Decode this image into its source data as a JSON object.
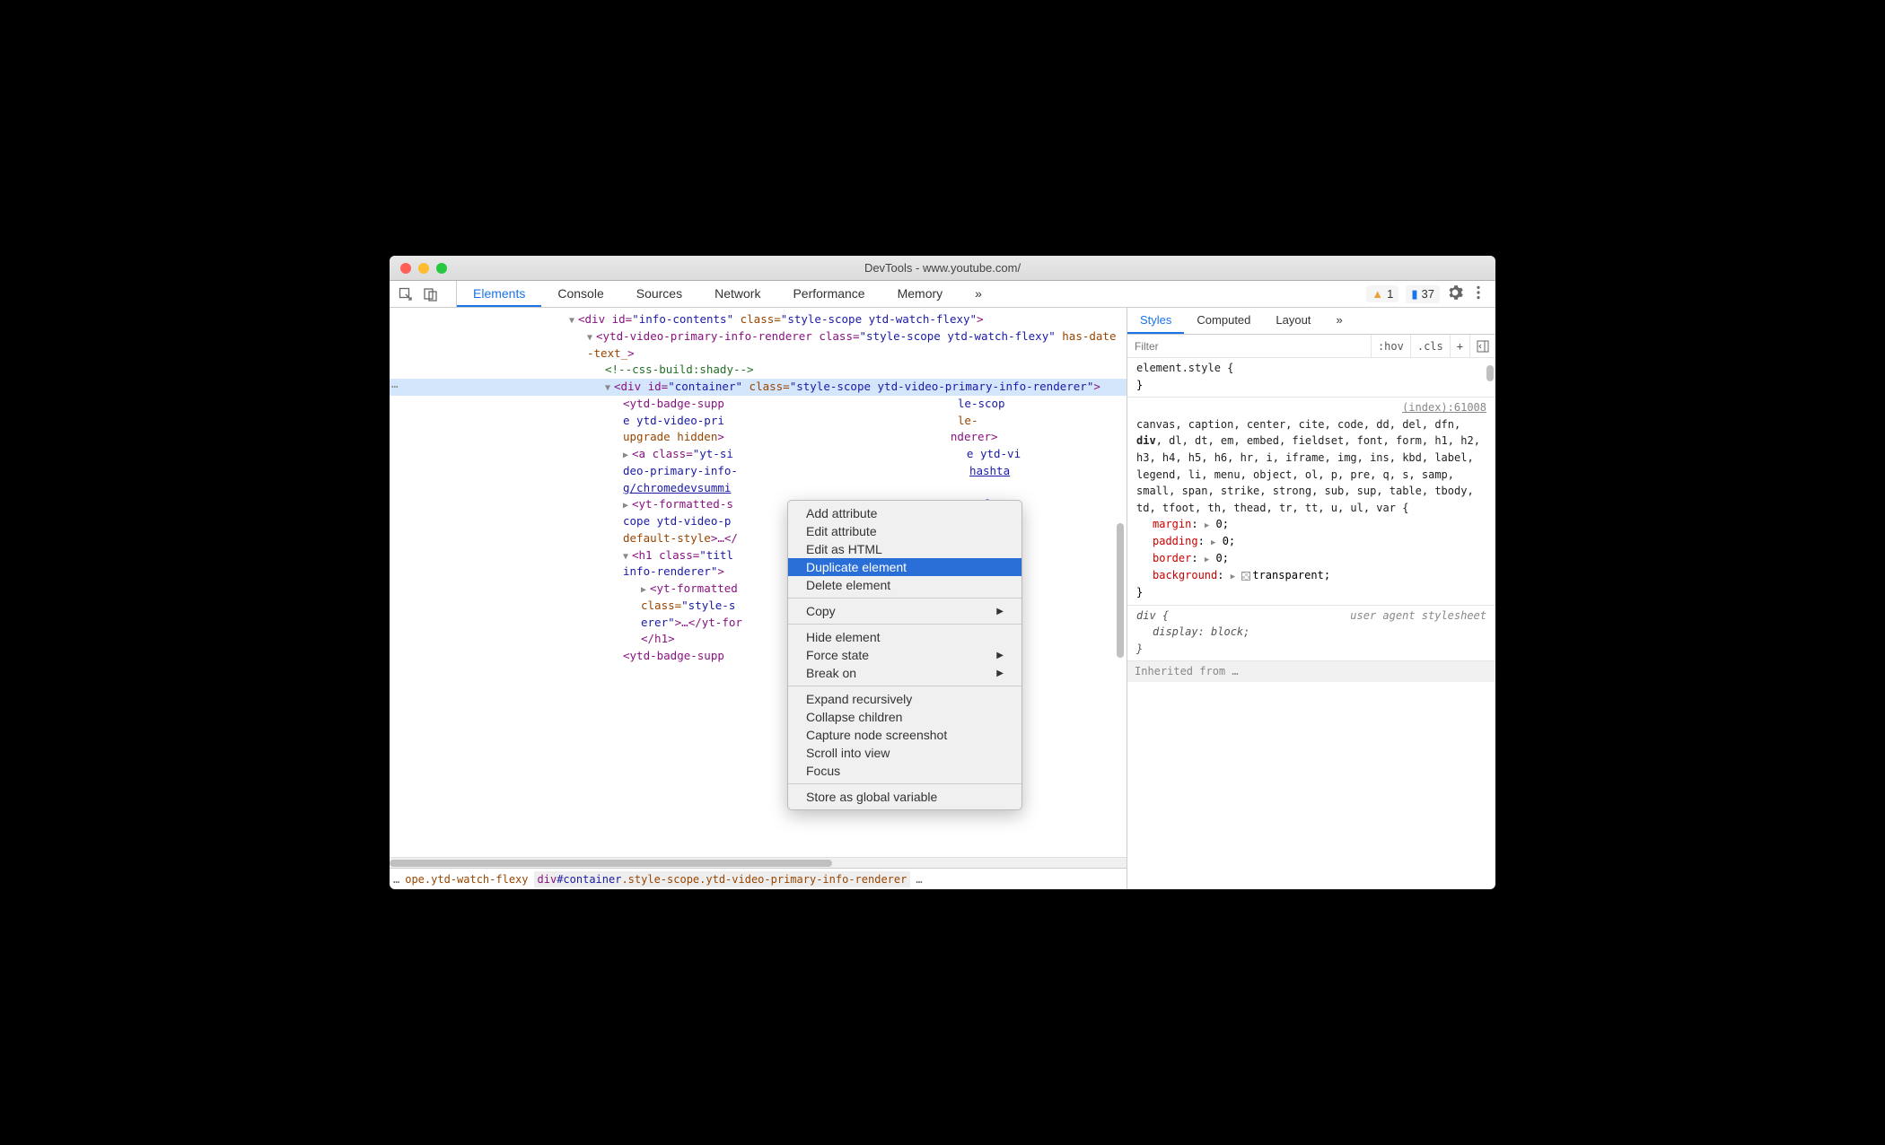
{
  "window_title": "DevTools - www.youtube.com/",
  "toolbar": {
    "tabs": [
      "Elements",
      "Console",
      "Sources",
      "Network",
      "Performance",
      "Memory"
    ],
    "active_tab": "Elements",
    "more": "»",
    "warnings": "1",
    "messages": "37"
  },
  "dom": {
    "line1_pre": "<div id=",
    "line1_id": "\"info-contents\"",
    "line1_class_attr": " class=",
    "line1_class_val": "\"style-scope ytd-watch-flexy\"",
    "line1_close": ">",
    "line2_pre": "<ytd-video-primary-info-renderer class=",
    "line2_class_val": "\"style-scope ytd-watch-flexy\"",
    "line2_hdt": " has-date-text_",
    "line2_close": ">",
    "comment": "<!--css-build:shady-->",
    "sel_pre": "<div id=",
    "sel_id": "\"container\"",
    "sel_class_attr": " class=",
    "sel_class_val": "\"style-scope ytd-video-primary-info-renderer\"",
    "sel_close": ">",
    "badge_pre": "<ytd-badge-supp",
    "badge_mid": " le-scope ytd-video-pri",
    "badge_mid2": " le-upgrade hidden>",
    "badge_end": "nderer>",
    "a_pre": "<a class=",
    "a_class": "\"yt-si",
    "a_mid": " ytd-video-primary-info-",
    "a_url": "hashtag/chromedevsummit",
    "ytf_pre": "<yt-formatted-s",
    "ytf_mid": "style-scope ytd-video-p",
    "ytf_mid2": "ce-default-style>",
    "ytf_close": "…</",
    "h1_pre": "<h1 class=",
    "h1_class": "\"titl",
    "h1_mid": "primary-info-renderer\"",
    "h1_close": ">",
    "h1_inner_pre": "<yt-formatted",
    "h1_inner_class": "class=\"style-s",
    "h1_inner_mid": "fo-renderer\">…</yt-for",
    "h1_end": "</h1>",
    "last_pre": "<ytd-badge-supp",
    "last_end": "le-scop"
  },
  "breadcrumb": {
    "ellipsis_left": "…",
    "item1": "ope.ytd-watch-flexy",
    "item2_tag": "div",
    "item2_id": "#container",
    "item2_cls": ".style-scope.ytd-video-primary-info-renderer",
    "ellipsis_right": "…"
  },
  "styles": {
    "tabs": [
      "Styles",
      "Computed",
      "Layout"
    ],
    "more": "»",
    "filter_placeholder": "Filter",
    "hov": ":hov",
    "cls": ".cls",
    "plus": "+",
    "element_style_sel": "element.style {",
    "rule1_source": "(index):61008",
    "rule1_selector": "canvas, caption, center, cite, code, dd, del, dfn, div, dl, dt, em, embed, fieldset, font, form, h1, h2, h3, h4, h5, h6, hr, i, iframe, img, ins, kbd, label, legend, li, menu, object, ol, p, pre, q, s, samp, small, span, strike, strong, sub, sup, table, tbody, td, tfoot, th, thead, tr, tt, u, ul, var {",
    "margin": "margin",
    "margin_v": "0",
    "padding": "padding",
    "padding_v": "0",
    "border": "border",
    "border_v": "0",
    "background": "background",
    "background_v": "transparent",
    "brace_close": "}",
    "ua_label": "user agent stylesheet",
    "ua_selector": "div {",
    "display": "display",
    "display_v": "block",
    "inherited": "Inherited from …"
  },
  "context_menu": {
    "items": [
      {
        "label": "Add attribute",
        "highlighted": false
      },
      {
        "label": "Edit attribute",
        "highlighted": false
      },
      {
        "label": "Edit as HTML",
        "highlighted": false
      },
      {
        "label": "Duplicate element",
        "highlighted": true
      },
      {
        "label": "Delete element",
        "highlighted": false
      }
    ],
    "group2": [
      {
        "label": "Copy",
        "submenu": true
      }
    ],
    "group3": [
      {
        "label": "Hide element",
        "submenu": false
      },
      {
        "label": "Force state",
        "submenu": true
      },
      {
        "label": "Break on",
        "submenu": true
      }
    ],
    "group4": [
      {
        "label": "Expand recursively",
        "submenu": false
      },
      {
        "label": "Collapse children",
        "submenu": false
      },
      {
        "label": "Capture node screenshot",
        "submenu": false
      },
      {
        "label": "Scroll into view",
        "submenu": false
      },
      {
        "label": "Focus",
        "submenu": false
      }
    ],
    "group5": [
      {
        "label": "Store as global variable",
        "submenu": false
      }
    ]
  }
}
